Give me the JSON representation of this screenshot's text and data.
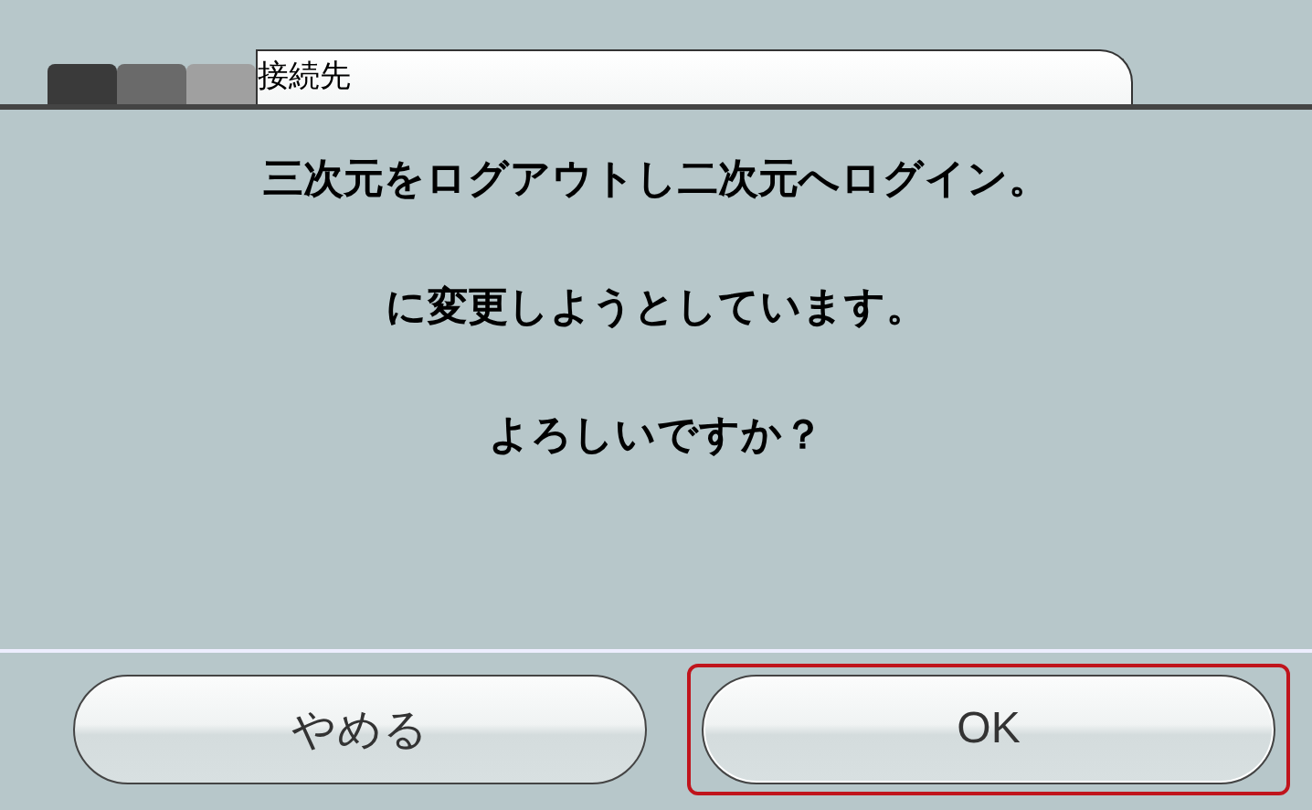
{
  "header": {
    "title": "接続先"
  },
  "message": [
    "三次元をログアウトし二次元へログイン。",
    "に変更しようとしています。",
    "よろしいですか？"
  ],
  "buttons": [
    {
      "label": "やめる",
      "selected": false
    },
    {
      "label": "OK",
      "selected": true
    }
  ]
}
